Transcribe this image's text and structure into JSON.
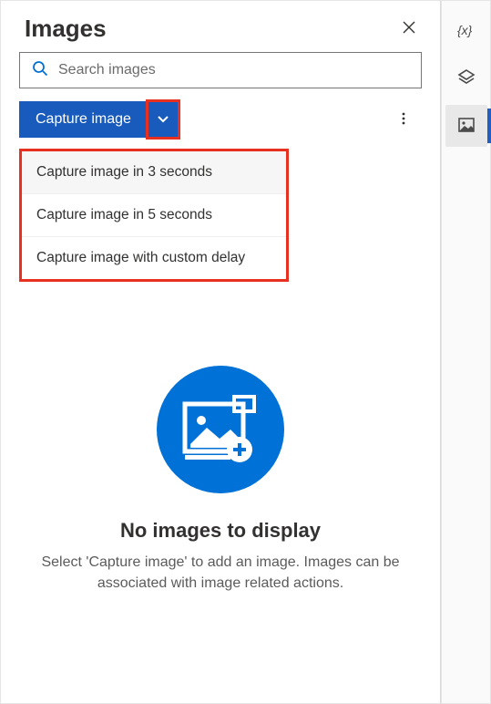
{
  "panel": {
    "title": "Images",
    "search_placeholder": "Search images",
    "capture_label": "Capture image",
    "dropdown": {
      "items": [
        "Capture image in 3 seconds",
        "Capture image in 5 seconds",
        "Capture image with custom delay"
      ]
    },
    "empty": {
      "title": "No images to display",
      "desc": "Select 'Capture image' to add an image. Images can be associated with image related actions."
    }
  },
  "rail": {
    "items": [
      "variables",
      "ui-elements",
      "images"
    ]
  }
}
